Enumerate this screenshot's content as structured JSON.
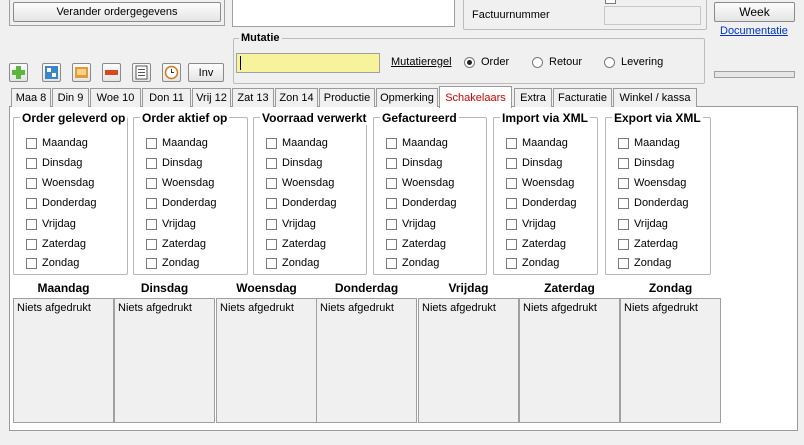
{
  "top": {
    "change_order_button": "Verander ordergegevens",
    "factuurnummer_label": "Factuurnummer",
    "week_button": "Week",
    "documentatie_link": "Documentatie",
    "inv_button": "Inv"
  },
  "toolbar_icons": [
    "add-icon",
    "grid-icon",
    "image-icon",
    "minus-icon",
    "list-icon",
    "clock-icon"
  ],
  "mutatie": {
    "title": "Mutatie",
    "input_value": "",
    "regel_label": "Mutatieregel",
    "options": [
      {
        "label": "Order",
        "selected": true
      },
      {
        "label": "Retour",
        "selected": false
      },
      {
        "label": "Levering",
        "selected": false
      }
    ]
  },
  "tabs": [
    {
      "label": "Maa 8"
    },
    {
      "label": "Din 9"
    },
    {
      "label": "Woe 10"
    },
    {
      "label": "Don 11"
    },
    {
      "label": "Vrij 12"
    },
    {
      "label": "Zat 13"
    },
    {
      "label": "Zon 14"
    },
    {
      "label": "Productie"
    },
    {
      "label": "Opmerking"
    },
    {
      "label": "Schakelaars",
      "active": true
    },
    {
      "label": "Extra"
    },
    {
      "label": "Facturatie"
    },
    {
      "label": "Winkel / kassa"
    }
  ],
  "groups": [
    {
      "title": "Order geleverd op"
    },
    {
      "title": "Order aktief op"
    },
    {
      "title": "Voorraad verwerkt"
    },
    {
      "title": "Gefactureerd"
    },
    {
      "title": "Import via XML"
    },
    {
      "title": "Export via XML"
    }
  ],
  "days": [
    "Maandag",
    "Dinsdag",
    "Woensdag",
    "Donderdag",
    "Vrijdag",
    "Zaterdag",
    "Zondag"
  ],
  "print_status": [
    {
      "day": "Maandag",
      "text": "Niets afgedrukt"
    },
    {
      "day": "Dinsdag",
      "text": "Niets afgedrukt"
    },
    {
      "day": "Woensdag",
      "text": "Niets afgedrukt"
    },
    {
      "day": "Donderdag",
      "text": "Niets afgedrukt"
    },
    {
      "day": "Vrijdag",
      "text": "Niets afgedrukt"
    },
    {
      "day": "Zaterdag",
      "text": "Niets afgedrukt"
    },
    {
      "day": "Zondag",
      "text": "Niets afgedrukt"
    }
  ]
}
